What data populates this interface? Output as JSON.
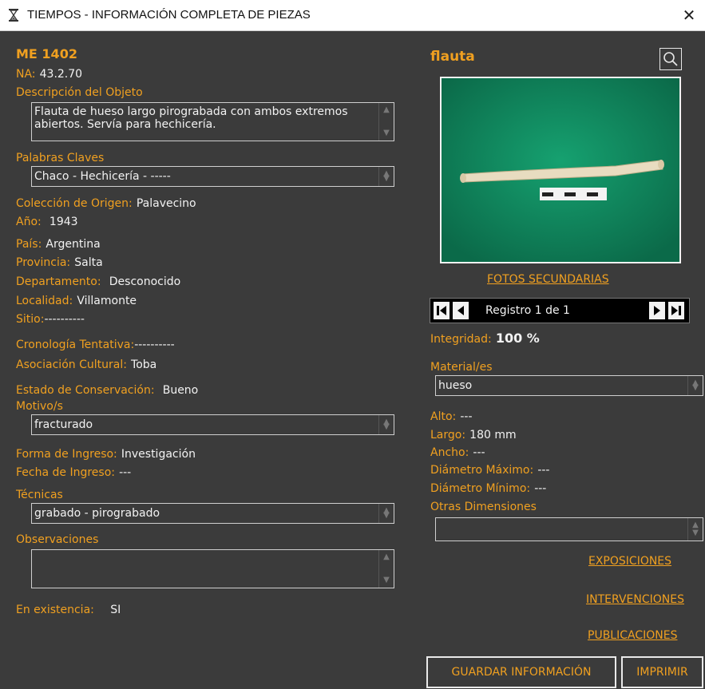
{
  "window": {
    "title": "TIEMPOS - INFORMACIÓN COMPLETA DE PIEZAS",
    "close_glyph": "✕",
    "title_icon": "hourglass-icon"
  },
  "left": {
    "code": "ME 1402",
    "na_label": "NA:",
    "na_value": "43.2.70",
    "descripcion_label": "Descripción del Objeto",
    "descripcion_value": "Flauta de hueso largo pirograbada con ambos extremos abiertos. Servía para hechicería.",
    "palabras_label": "Palabras Claves",
    "palabras_value": "Chaco - Hechicería - -----",
    "coleccion_label": "Colección de Origen:",
    "coleccion_value": "Palavecino",
    "anio_label": "Año:",
    "anio_value": "1943",
    "pais_label": "País:",
    "pais_value": "Argentina",
    "provincia_label": "Provincia:",
    "provincia_value": "Salta",
    "departamento_label": "Departamento:",
    "departamento_value": "Desconocido",
    "localidad_label": "Localidad:",
    "localidad_value": "Villamonte",
    "sitio_label": "Sitio:",
    "sitio_value": "----------",
    "cronologia_label": "Cronología Tentativa:",
    "cronologia_value": "----------",
    "asociacion_label": "Asociación Cultural:",
    "asociacion_value": "Toba",
    "estado_label": "Estado de Conservación:",
    "estado_value": "Bueno",
    "motivos_label": "Motivo/s",
    "motivos_value": "fracturado",
    "forma_label": "Forma de Ingreso:",
    "forma_value": "Investigación",
    "fecha_label": "Fecha de Ingreso:",
    "fecha_value": "---",
    "tecnicas_label": "Técnicas",
    "tecnicas_value": "grabado - pirograbado",
    "observaciones_label": "Observaciones",
    "observaciones_value": "",
    "existencia_label": "En existencia:",
    "existencia_value": "SI"
  },
  "right": {
    "name": "flauta",
    "fotos_link": "FOTOS SECUNDARIAS",
    "record_text": "Registro 1 de 1",
    "integridad_label": "Integridad:",
    "integridad_value": "100 %",
    "material_label": "Material/es",
    "material_value": "hueso",
    "alto_label": "Alto:",
    "alto_value": "---",
    "largo_label": "Largo:",
    "largo_value": "180 mm",
    "ancho_label": "Ancho:",
    "ancho_value": "---",
    "dmax_label": "Diámetro Máximo:",
    "dmax_value": "---",
    "dmin_label": "Diámetro Mínimo:",
    "dmin_value": "---",
    "otras_label": "Otras Dimensiones",
    "otras_value": "",
    "links": {
      "exposiciones": "EXPOSICIONES",
      "intervenciones": "INTERVENCIONES",
      "publicaciones": "PUBLICACIONES"
    },
    "buttons": {
      "guardar": "GUARDAR INFORMACIÓN",
      "imprimir": "IMPRIMIR"
    }
  },
  "colors": {
    "background": "#3b3b3b",
    "label": "#f0a020",
    "value": "#f2f2f2",
    "photo_bg": "#0f7a55"
  }
}
